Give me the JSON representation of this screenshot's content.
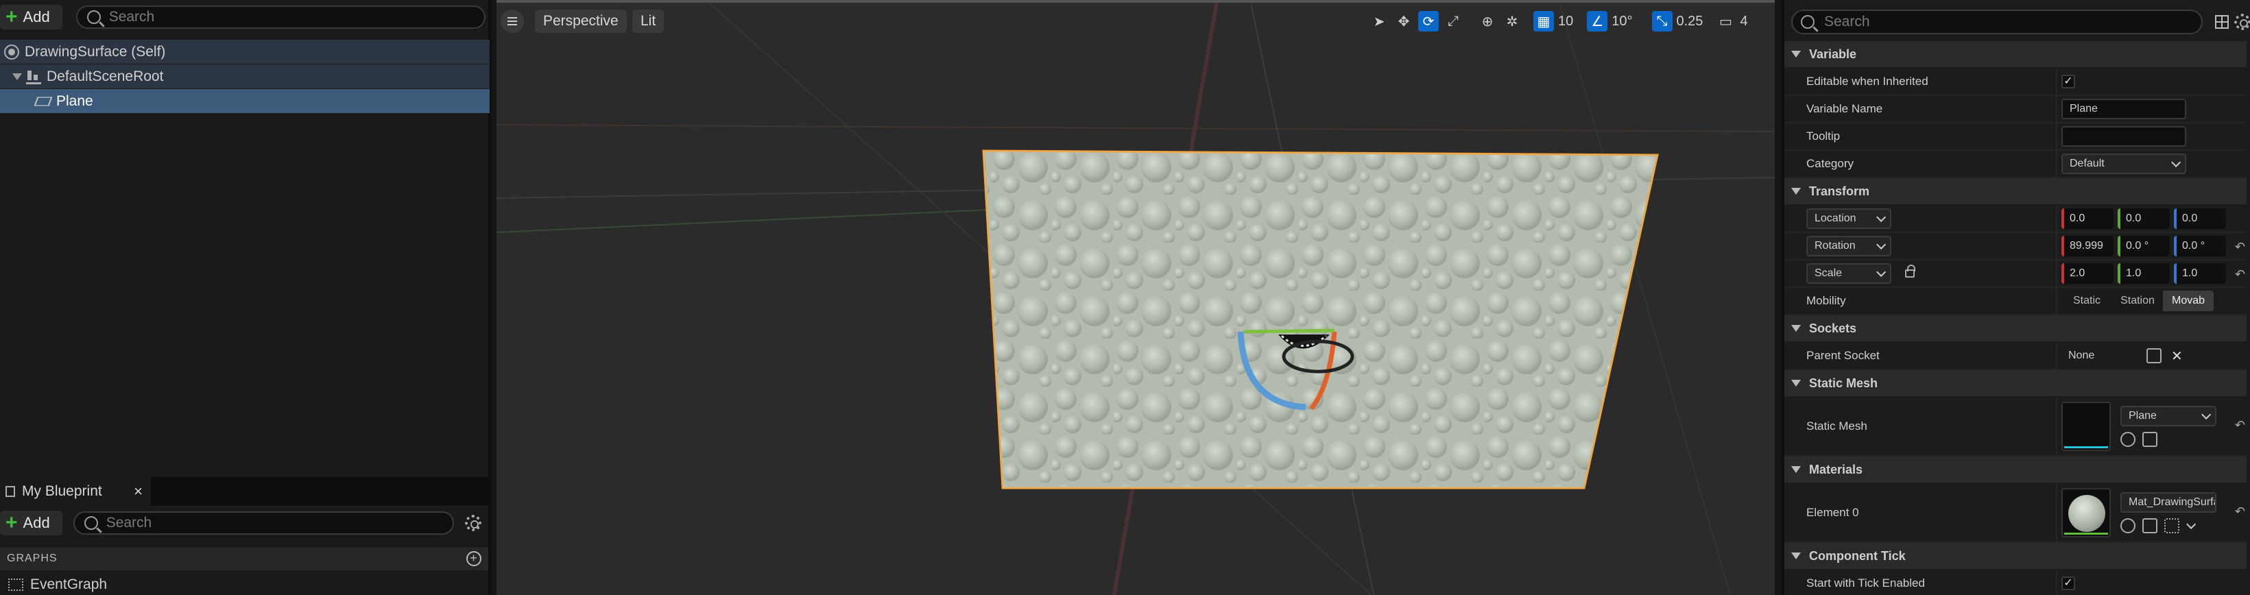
{
  "components_panel": {
    "add_label": "Add",
    "search_placeholder": "Search",
    "tree": [
      {
        "label": "DrawingSurface (Self)"
      },
      {
        "label": "DefaultSceneRoot"
      },
      {
        "label": "Plane"
      }
    ]
  },
  "my_blueprint": {
    "tab_label": "My Blueprint",
    "close_glyph": "×",
    "add_label": "Add",
    "search_placeholder": "Search",
    "graphs_header": "GRAPHS",
    "graphs_add_glyph": "+",
    "items": [
      {
        "label": "EventGraph"
      }
    ]
  },
  "viewport": {
    "view_mode": "Perspective",
    "lighting": "Lit",
    "grid_snap_value": "10",
    "rotation_snap_value": "10°",
    "scale_snap_value": "0.25",
    "camera_speed_value": "4",
    "colors": {
      "selection_outline": "#f2a23a",
      "rotate_x": "#e0602a",
      "rotate_y": "#5a9ad6",
      "rotate_z": "#7fbf3f"
    }
  },
  "details_panel": {
    "search_placeholder": "Search",
    "sections": {
      "variable": "Variable",
      "transform": "Transform",
      "sockets": "Sockets",
      "static_mesh": "Static Mesh",
      "materials": "Materials",
      "component_tick": "Component Tick"
    },
    "variable": {
      "editable_label": "Editable when Inherited",
      "editable_checked": "✓",
      "name_label": "Variable Name",
      "name_value": "Plane",
      "tooltip_label": "Tooltip",
      "tooltip_value": "",
      "category_label": "Category",
      "category_value": "Default"
    },
    "transform": {
      "location_label": "Location",
      "location": [
        "0.0",
        "0.0",
        "0.0"
      ],
      "rotation_label": "Rotation",
      "rotation": [
        "89.999",
        "0.0 °",
        "0.0 °"
      ],
      "scale_label": "Scale",
      "scale": [
        "2.0",
        "1.0",
        "1.0"
      ],
      "mobility_label": "Mobility",
      "mobility_options": [
        "Static",
        "Station",
        "Movab"
      ],
      "reset_glyph": "↶"
    },
    "sockets": {
      "parent_label": "Parent Socket",
      "parent_value": "None",
      "clear_glyph": "✕"
    },
    "static_mesh": {
      "label": "Static Mesh",
      "value": "Plane"
    },
    "materials": {
      "element_label": "Element 0",
      "value": "Mat_DrawingSurfa"
    },
    "component_tick": {
      "start_label": "Start with Tick Enabled",
      "checked": "✓"
    }
  }
}
